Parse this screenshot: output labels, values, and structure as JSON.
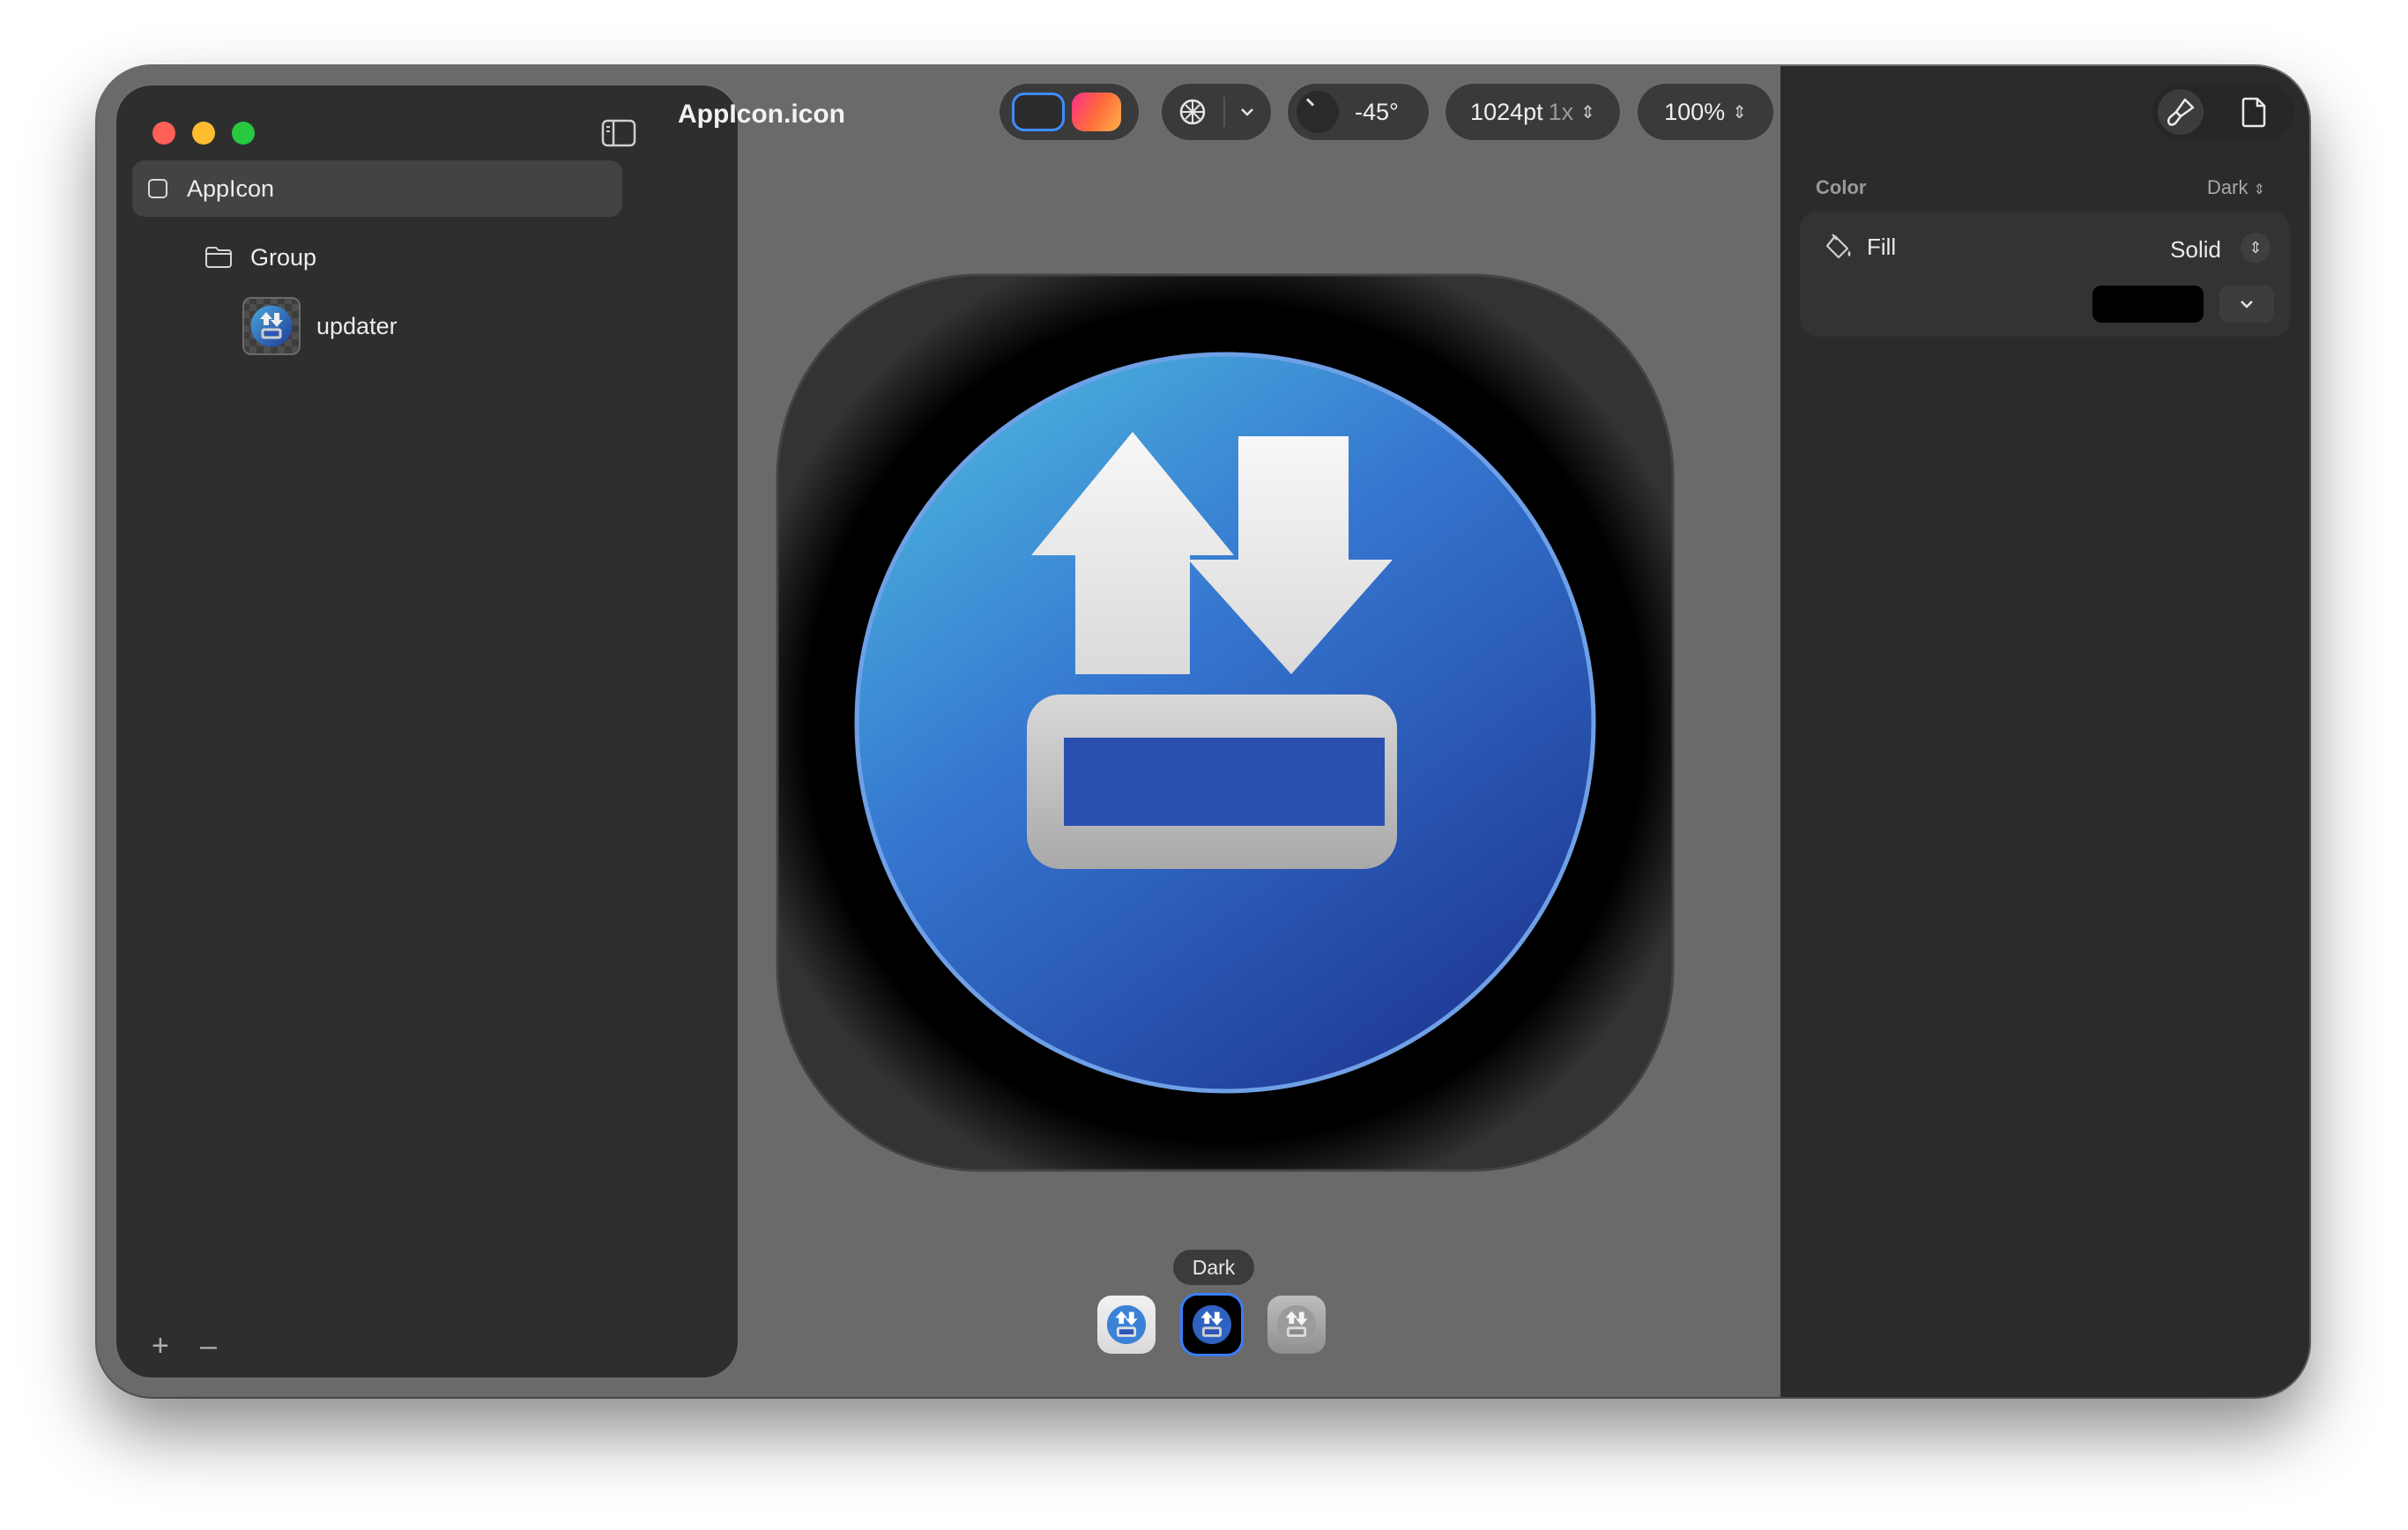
{
  "sidebar": {
    "root_label": "AppIcon",
    "group_label": "Group",
    "layer_label": "updater",
    "add_label": "+",
    "remove_label": "–"
  },
  "toolbar": {
    "file_title": "AppIcon.icon",
    "angle_value": "-45°",
    "size_value": "1024pt",
    "scale_value": "1x",
    "zoom_value": "100%"
  },
  "canvas": {
    "hover_tooltip": "Dark"
  },
  "inspector": {
    "section_label": "Color",
    "appearance_mode": "Dark",
    "fill_label": "Fill",
    "fill_type": "Solid",
    "fill_color": "#000000"
  },
  "colors": {
    "icon_gradient_top": "#4aa6dc",
    "icon_gradient_bottom": "#1f3b96",
    "selection_accent": "#3f8cff"
  }
}
